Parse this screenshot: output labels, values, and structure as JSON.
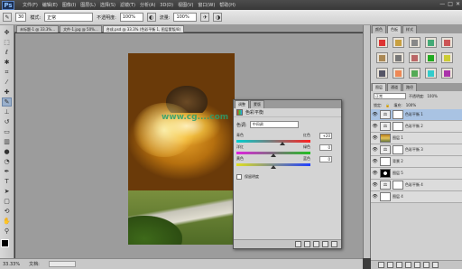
{
  "app": {
    "logo": "Ps",
    "menu": [
      "文件(F)",
      "编辑(E)",
      "图像(I)",
      "图层(L)",
      "选择(S)",
      "滤镜(T)",
      "分析(A)",
      "3D(D)",
      "视图(V)",
      "窗口(W)",
      "帮助(H)"
    ],
    "window_controls": [
      "—",
      "□",
      "✕"
    ]
  },
  "options": {
    "size": "30",
    "mode_label": "模式:",
    "mode": "正常",
    "opacity_label": "不透明度:",
    "opacity": "100%",
    "flow_label": "流量:",
    "flow": "100%"
  },
  "doc_tabs": [
    "未标题-1 @ 33.3%...",
    "文件-1.jpg @ 50%...",
    "合成.psd @ 33.3% (色彩平衡 1, 图层蒙版/8)"
  ],
  "status": {
    "zoom": "33.33%",
    "doc": "文档:"
  },
  "adjustments": {
    "tabs": [
      "调整",
      "蒙版"
    ],
    "title": "色彩平衡",
    "tone_label": "色调:",
    "tone": "中间调",
    "sliders": [
      {
        "left": "青色",
        "right": "红色",
        "value": "+20",
        "pos": 0.62,
        "gradient": "linear-gradient(90deg,#00d0d0,#ff2020)"
      },
      {
        "left": "洋红",
        "right": "绿色",
        "value": "0",
        "pos": 0.5,
        "gradient": "linear-gradient(90deg,#e020e0,#20c020)"
      },
      {
        "left": "黄色",
        "right": "蓝色",
        "value": "0",
        "pos": 0.5,
        "gradient": "linear-gradient(90deg,#e0e020,#2040ff)"
      }
    ],
    "preserve": "保留明度"
  },
  "watermark": "www.cg....com",
  "panels": {
    "swatch_tabs": [
      "颜色",
      "色板",
      "样式"
    ],
    "layer_tabs": [
      "图层",
      "通道",
      "路径"
    ],
    "blend": "正常",
    "opacity_label": "不透明度:",
    "opacity": "100%",
    "lock_label": "锁定:",
    "fill_label": "填充:",
    "fill": "100%",
    "layers": [
      {
        "name": "色彩平衡 1",
        "thumb": "adj",
        "selected": true
      },
      {
        "name": "色彩平衡 2",
        "thumb": "adj",
        "selected": false
      },
      {
        "name": "图层 1",
        "thumb": "img",
        "selected": false
      },
      {
        "name": "色彩平衡 3",
        "thumb": "adj",
        "selected": false
      },
      {
        "name": "背景 2",
        "thumb": "mask",
        "selected": false
      },
      {
        "name": "图层 5",
        "thumb": "blk",
        "selected": false
      },
      {
        "name": "色彩平衡 4",
        "thumb": "adj",
        "selected": false
      },
      {
        "name": "图层 4",
        "thumb": "mask",
        "selected": false
      }
    ]
  },
  "colors": {
    "accent": "#a9c3e3",
    "panel": "#d4d4d4"
  }
}
